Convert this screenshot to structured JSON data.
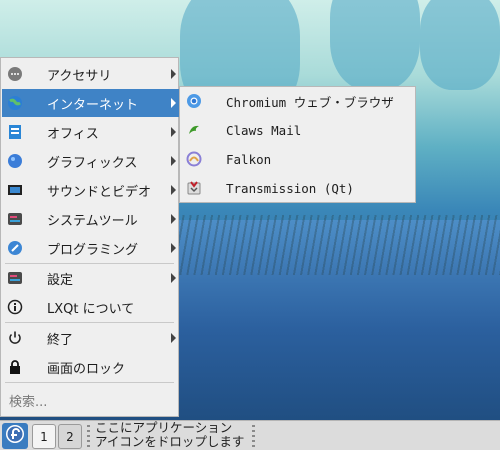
{
  "menu": {
    "items": [
      {
        "label": "アクセサリ",
        "icon": "accessories-icon",
        "submenu": true
      },
      {
        "label": "インターネット",
        "icon": "internet-icon",
        "submenu": true,
        "active": true
      },
      {
        "label": "オフィス",
        "icon": "office-icon",
        "submenu": true
      },
      {
        "label": "グラフィックス",
        "icon": "graphics-icon",
        "submenu": true
      },
      {
        "label": "サウンドとビデオ",
        "icon": "sound-video-icon",
        "submenu": true
      },
      {
        "label": "システムツール",
        "icon": "system-tools-icon",
        "submenu": true
      },
      {
        "label": "プログラミング",
        "icon": "programming-icon",
        "submenu": true
      }
    ],
    "settings": {
      "label": "設定",
      "icon": "settings-icon"
    },
    "about": {
      "label": "LXQt について",
      "icon": "info-icon"
    },
    "quit": {
      "label": "終了",
      "icon": "power-icon"
    },
    "lock": {
      "label": "画面のロック",
      "icon": "lock-icon"
    },
    "search_placeholder": "検索..."
  },
  "internet_submenu": [
    {
      "label": "Chromium ウェブ・ブラウザ",
      "icon": "chromium-icon"
    },
    {
      "label": "Claws Mail",
      "icon": "claws-mail-icon"
    },
    {
      "label": "Falkon",
      "icon": "falkon-icon"
    },
    {
      "label": "Transmission (Qt)",
      "icon": "transmission-icon"
    }
  ],
  "panel": {
    "desktop1": "1",
    "desktop2": "2",
    "quicklaunch_line1": "ここにアプリケーション",
    "quicklaunch_line2": "アイコンをドロップします"
  },
  "colors": {
    "accent": "#3f83c6",
    "menu_bg": "#efefef",
    "panel_bg": "#dcdcdc"
  }
}
